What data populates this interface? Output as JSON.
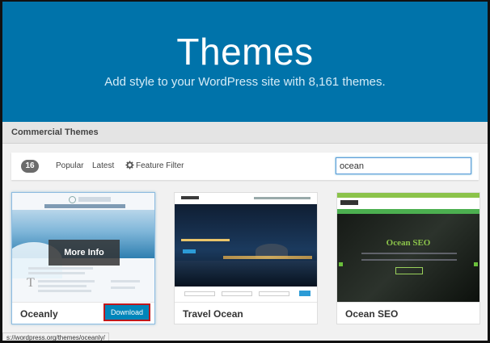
{
  "hero": {
    "title": "Themes",
    "subtitle": "Add style to your WordPress site with 8,161 themes."
  },
  "section": {
    "title": "Commercial Themes"
  },
  "filter": {
    "count": "16",
    "popular": "Popular",
    "latest": "Latest",
    "feature_filter": "Feature Filter",
    "search_value": "ocean"
  },
  "themes": [
    {
      "name": "Oceanly",
      "overlay_label": "More Info",
      "download_label": "Download",
      "preview_title": "Oceanly Theme"
    },
    {
      "name": "Travel Ocean",
      "preview_title": "Travel Ocean"
    },
    {
      "name": "Ocean SEO",
      "preview_title": "Ocean SEO"
    }
  ],
  "status_bar": {
    "url": "s://wordpress.org/themes/oceanly/"
  },
  "colors": {
    "hero": "#0073aa",
    "download": "#0085ba",
    "highlight": "#c0171b",
    "seo_green": "#8bc34a"
  }
}
